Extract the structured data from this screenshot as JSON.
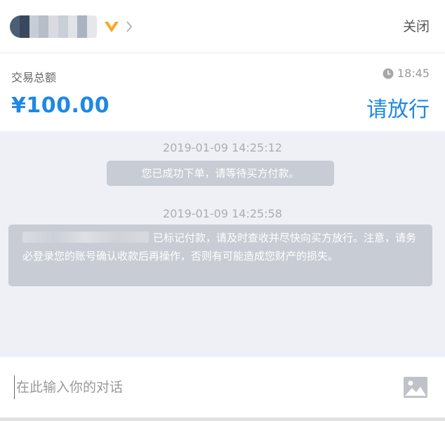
{
  "header": {
    "close_label": "关闭",
    "vip_icon": "vip-badge-icon",
    "chevron_icon": "chevron-right-icon",
    "avatar_blur_colors": [
      "#4b5e75",
      "#39485c",
      "#c6cdd6",
      "#b8bec8",
      "#d8dce2",
      "#c9cfd7",
      "#e0e3e7",
      "#aab4c0",
      "#e5e7ea"
    ]
  },
  "trade": {
    "label": "交易总额",
    "time": "18:45",
    "amount": "¥100.00",
    "action_label": "请放行"
  },
  "chat": {
    "messages": [
      {
        "time": "2019-01-09 14:25:12",
        "text": "您已成功下单，请等待买方付款。"
      },
      {
        "time": "2019-01-09 14:25:58",
        "text": "已标记付款，请及时查收并尽快向买方放行。注意，请务必登录您的账号确认收款后再操作，否则有可能造成您财产的损失。"
      }
    ]
  },
  "input": {
    "placeholder": "在此输入你的对话"
  },
  "colors": {
    "accent": "#1e88e5",
    "vip": "#f5a623",
    "bubble": "#c7ccd5",
    "chat_bg": "#eef0f5"
  }
}
